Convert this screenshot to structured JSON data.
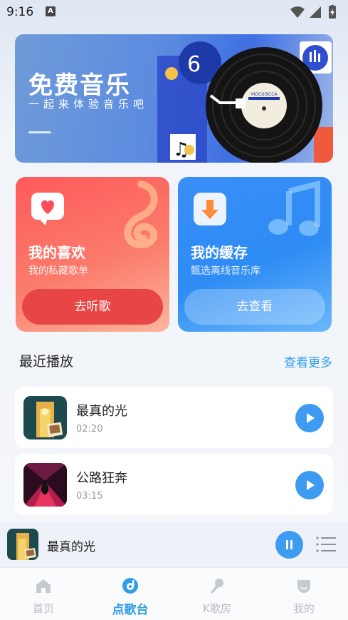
{
  "status_bar": {
    "time": "9:16",
    "notification_badge": "A",
    "icons": [
      "wifi-icon",
      "signal-icon",
      "battery-icon"
    ]
  },
  "banner": {
    "title": "免费音乐",
    "subtitle": "一起来体验音乐吧",
    "record_label_text": "MOCUISCCA"
  },
  "cards": [
    {
      "title": "我的喜欢",
      "subtitle": "我的私藏歌单",
      "button": "去听歌",
      "icon": "heart-icon",
      "color": "#ff5a5a"
    },
    {
      "title": "我的缓存",
      "subtitle": "甄选离线音乐库",
      "button": "去查看",
      "icon": "download-icon",
      "color": "#3a8df8"
    }
  ],
  "recent": {
    "title": "最近播放",
    "more": "查看更多",
    "songs": [
      {
        "name": "最真的光",
        "duration": "02:20"
      },
      {
        "name": "公路狂奔",
        "duration": "03:15"
      }
    ]
  },
  "mini_player": {
    "title": "最真的光",
    "state": "playing"
  },
  "bottom_nav": {
    "items": [
      {
        "label": "首页",
        "icon": "home-icon",
        "active": false
      },
      {
        "label": "点歌台",
        "icon": "music-disc-icon",
        "active": true
      },
      {
        "label": "K歌房",
        "icon": "microphone-icon",
        "active": false
      },
      {
        "label": "我的",
        "icon": "profile-icon",
        "active": false
      }
    ]
  },
  "colors": {
    "accent": "#2e9ee8",
    "play_button": "#3d9bf1",
    "nav_inactive": "#b8bcc4"
  }
}
